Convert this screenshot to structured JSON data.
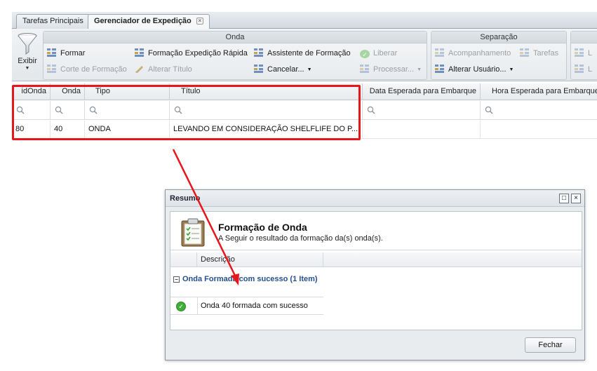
{
  "tabs": [
    {
      "label": "Tarefas Principais"
    },
    {
      "label": "Gerenciador de Expedição"
    }
  ],
  "tab_close_glyph": "×",
  "ribbon": {
    "exibir_label": "Exibir",
    "groups": [
      {
        "title": "Onda"
      },
      {
        "title": "Separação"
      }
    ],
    "onda": {
      "formar": "Formar",
      "corte_formacao": "Corte de Formação",
      "formacao_rapida": "Formação Expedição Rápida",
      "alterar_titulo": "Alterar Título",
      "assistente": "Assistente de Formação",
      "cancelar": "Cancelar...",
      "liberar": "Liberar",
      "processar": "Processar..."
    },
    "separacao": {
      "acompanhamento": "Acompanhamento",
      "tarefas": "Tarefas",
      "alterar_usuario": "Alterar Usuário..."
    },
    "trailing_fragment": "L"
  },
  "grid": {
    "columns": [
      "idOnda",
      "Onda",
      "Tipo",
      "Título",
      "Data Esperada para Embarque",
      "Hora Esperada para Embarque"
    ],
    "row": [
      "80",
      "40",
      "ONDA",
      "LEVANDO EM CONSIDERAÇÃO SHELFLIFE DO P...",
      "",
      ""
    ]
  },
  "dialog": {
    "title": "Resumo",
    "heading": "Formação de Onda",
    "subheading": "A Seguir o resultado da formação da(s) onda(s).",
    "column_descricao": "Descrição",
    "group_label": "Onda Formada com sucesso (1 Item)",
    "result_text": "Onda 40 formada com sucesso",
    "close_button": "Fechar",
    "maximize_glyph": "□",
    "close_glyph": "×",
    "group_toggle_glyph": "−"
  },
  "colors": {
    "annotation_red": "#e8161b",
    "group_blue": "#24508f",
    "success_green": "#3fae38"
  }
}
